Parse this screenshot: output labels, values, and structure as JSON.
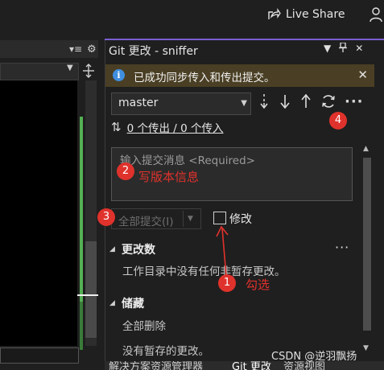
{
  "topbar": {
    "live_share_label": "Live Share"
  },
  "git_panel": {
    "title": "Git 更改 - sniffer",
    "info_bar": {
      "message": "已成功同步传入和传出提交。",
      "close_glyph": "✕"
    },
    "branch": {
      "name": "master"
    },
    "sync_actions": [
      "fetch-icon",
      "pull-icon",
      "push-icon",
      "sync-icon",
      "more-icon"
    ],
    "outgoing_incoming": "0 个传出 / 0 个传入",
    "commit_message": {
      "placeholder": "输入提交消息 <Required>",
      "annotation": "写版本信息"
    },
    "commit_all_label": "全部提交(I)",
    "amend_label": "修改",
    "changes": {
      "header": "更改数",
      "empty_text": "工作目录中没有任何非暂存更改。"
    },
    "stashes": {
      "header": "储藏",
      "delete_all": "全部删除",
      "empty_text": "没有暂存的更改。"
    },
    "bottom_tabs": [
      "解决方案资源管理器",
      "Git 更改",
      "资源视图"
    ]
  },
  "annotations": {
    "badges": [
      "1",
      "2",
      "3",
      "4"
    ],
    "select_label": "勾选",
    "color": "#e0322c"
  },
  "watermark": "CSDN @逆羽飘扬",
  "colors": {
    "accent": "#7a5fd1",
    "info_bar_bg": "#4a3f24",
    "info_icon": "#3f8ee0",
    "annotation_red": "#e0322c",
    "minimap_green": "#54b054"
  }
}
